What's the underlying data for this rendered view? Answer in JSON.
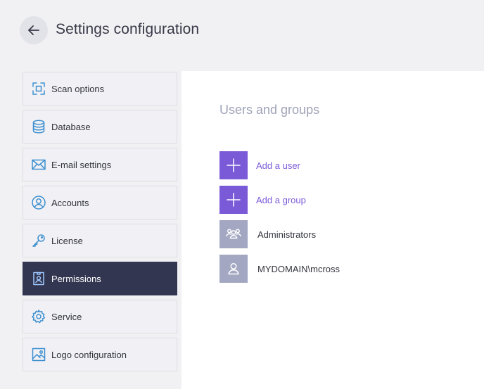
{
  "header": {
    "title": "Settings configuration",
    "back_icon": "arrow-left-icon"
  },
  "sidebar": {
    "active_index": 5,
    "items": [
      {
        "label": "Scan options",
        "icon": "scan-frame-icon"
      },
      {
        "label": "Database",
        "icon": "database-icon"
      },
      {
        "label": "E-mail settings",
        "icon": "envelope-icon"
      },
      {
        "label": "Accounts",
        "icon": "user-circle-icon"
      },
      {
        "label": "License",
        "icon": "key-icon"
      },
      {
        "label": "Permissions",
        "icon": "badge-icon"
      },
      {
        "label": "Service",
        "icon": "gear-icon"
      },
      {
        "label": "Logo configuration",
        "icon": "image-icon"
      }
    ]
  },
  "main": {
    "section_title": "Users and groups",
    "actions": [
      {
        "label": "Add a user",
        "icon": "plus-icon"
      },
      {
        "label": "Add a group",
        "icon": "plus-icon"
      }
    ],
    "members": [
      {
        "label": "Administrators",
        "icon": "group-icon"
      },
      {
        "label": "MYDOMAIN\\mcross",
        "icon": "user-icon"
      }
    ]
  },
  "colors": {
    "accent": "#7b5ad8",
    "active_nav": "#333651",
    "icon_blue": "#3c8fcf",
    "member_tile": "#a3a7c1"
  }
}
